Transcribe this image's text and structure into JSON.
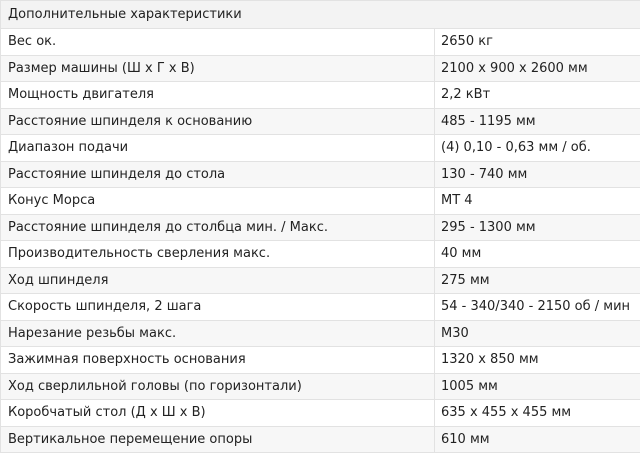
{
  "section_title": "Дополнительные характеристики",
  "rows": [
    {
      "label": "Вес ок.",
      "value": "2650 кг"
    },
    {
      "label": "Размер машины (Ш х Г х В)",
      "value": "2100 x 900 x 2600 мм"
    },
    {
      "label": "Мощность двигателя",
      "value": "2,2 кВт"
    },
    {
      "label": "Расстояние шпинделя к основанию",
      "value": "485 - 1195 мм"
    },
    {
      "label": "Диапазон подачи",
      "value": "(4) 0,10 - 0,63 мм / об."
    },
    {
      "label": "Расстояние шпинделя до стола",
      "value": "130 - 740 мм"
    },
    {
      "label": "Конус Морса",
      "value": "MT 4"
    },
    {
      "label": "Расстояние шпинделя до столбца мин. / Макс.",
      "value": "295 - 1300 мм"
    },
    {
      "label": "Производительность сверления макс.",
      "value": "40 мм"
    },
    {
      "label": "Ход шпинделя",
      "value": "275 мм"
    },
    {
      "label": "Скорость шпинделя, 2 шага",
      "value": "54 - 340/340 - 2150 об / мин"
    },
    {
      "label": "Нарезание резьбы макс.",
      "value": "M30"
    },
    {
      "label": "Зажимная поверхность основания",
      "value": "1320 x 850 мм"
    },
    {
      "label": "Ход сверлильной головы (по горизонтали)",
      "value": "1005 мм"
    },
    {
      "label": "Коробчатый стол (Д х Ш х В)",
      "value": "635 x 455 x 455 мм"
    },
    {
      "label": "Вертикальное перемещение опоры",
      "value": "610 мм"
    }
  ]
}
